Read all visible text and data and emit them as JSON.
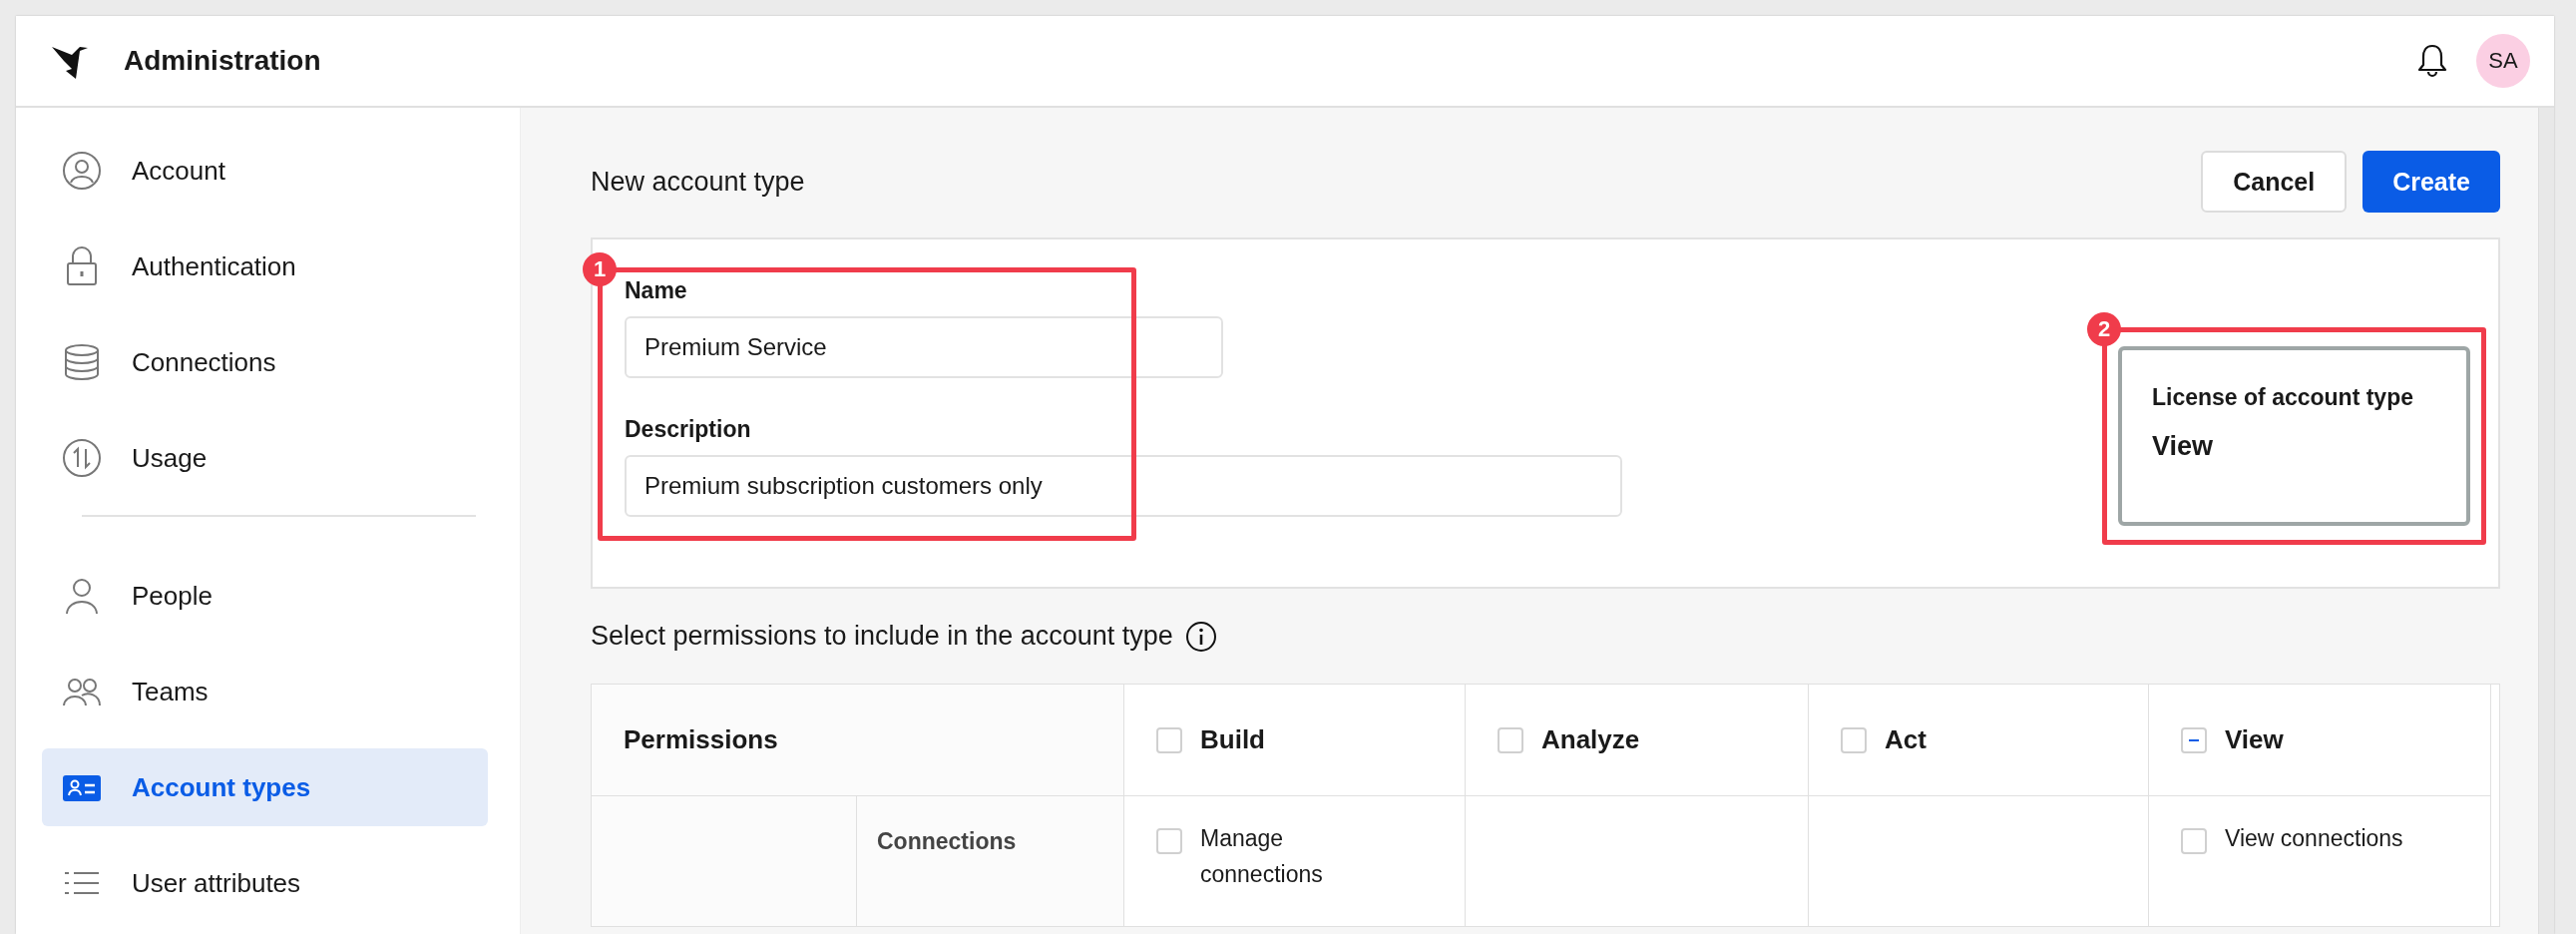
{
  "header": {
    "title": "Administration",
    "avatar": "SA"
  },
  "sidebar": {
    "sections": [
      [
        {
          "label": "Account",
          "selected": false
        },
        {
          "label": "Authentication",
          "selected": false
        },
        {
          "label": "Connections",
          "selected": false
        },
        {
          "label": "Usage",
          "selected": false
        }
      ],
      [
        {
          "label": "People",
          "selected": false
        },
        {
          "label": "Teams",
          "selected": false
        },
        {
          "label": "Account types",
          "selected": true
        },
        {
          "label": "User attributes",
          "selected": false
        }
      ]
    ]
  },
  "page": {
    "title": "New account type",
    "buttons": [
      {
        "label": "Cancel",
        "kind": "secondary"
      },
      {
        "label": "Create",
        "kind": "primary"
      }
    ]
  },
  "form": {
    "fields": [
      {
        "label": "Name",
        "value": "Premium Service",
        "kind": "short"
      },
      {
        "label": "Description",
        "value": "Premium subscription customers only",
        "kind": "long"
      }
    ],
    "license": {
      "label": "License of account type",
      "value": "View"
    }
  },
  "annotations": [
    {
      "number": "1"
    },
    {
      "number": "2"
    }
  ],
  "permissions": {
    "title": "Select permissions to include in the account type",
    "columns": [
      {
        "label": "Permissions",
        "kind": "label"
      },
      {
        "label": "Build",
        "kind": "license",
        "mixed": false
      },
      {
        "label": "Analyze",
        "kind": "license",
        "mixed": false
      },
      {
        "label": "Act",
        "kind": "license",
        "mixed": false
      },
      {
        "label": "View",
        "kind": "license",
        "mixed": true
      }
    ],
    "rows": [
      {
        "cells": [
          "Connections",
          {
            "label": "Manage connections",
            "checked": false
          },
          "",
          "",
          {
            "label": "View connections",
            "checked": false
          }
        ]
      }
    ]
  }
}
